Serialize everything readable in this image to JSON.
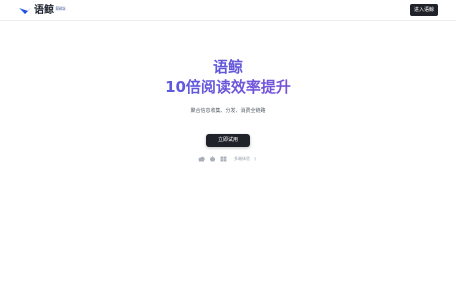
{
  "header": {
    "logo_text": "语鲸",
    "logo_badge": "Beta",
    "enter_button": "进入语鲸"
  },
  "hero": {
    "title": "语鲸",
    "subtitle": "10倍阅读效率提升",
    "tagline": "聚合信息收集、分发、消费全链路",
    "cta_label": "立即试用"
  },
  "platforms": {
    "icons": [
      "cloud-icon",
      "apple-icon",
      "windows-icon"
    ],
    "label": "多端体验",
    "help": "?"
  },
  "colors": {
    "accent_start": "#4a5ee0",
    "accent_end": "#7b4fd6",
    "button_dark": "#1f2329"
  }
}
